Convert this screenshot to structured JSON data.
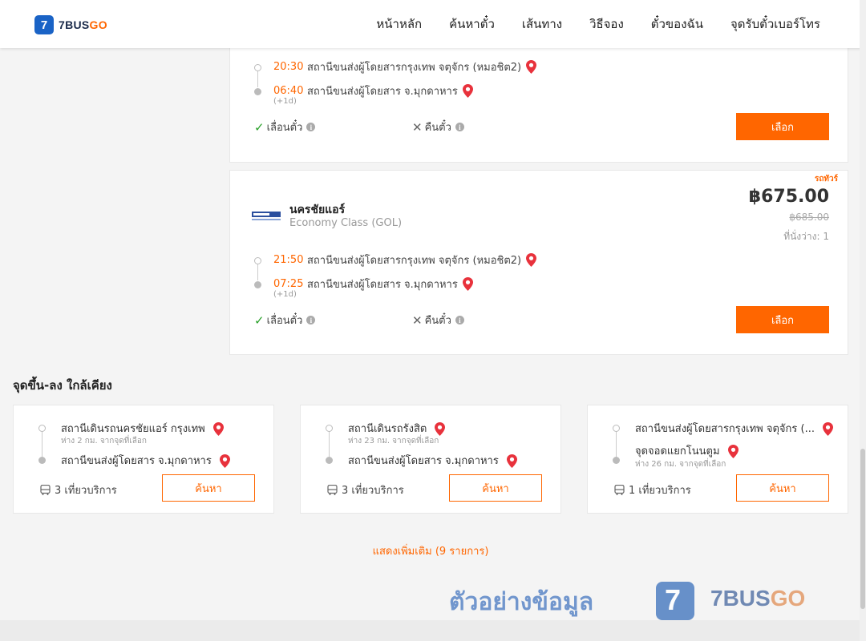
{
  "header": {
    "logo_badge": "7",
    "logo_text_a": "7BUS",
    "logo_text_b": "GO",
    "nav": [
      "หน้าหลัก",
      "ค้นหาตั๋ว",
      "เส้นทาง",
      "วิธีจอง",
      "ตั๋วของฉัน",
      "จุดรับตั๋วเบอร์โทร"
    ]
  },
  "trips": [
    {
      "depart_time": "20:30",
      "depart_stop": "สถานีขนส่งผู้โดยสารกรุงเทพ จตุจักร (หมอชิต2)",
      "arrive_time": "06:40",
      "arrive_stop": "สถานีขนส่งผู้โดยสาร จ.มุกดาหาร",
      "next_day": "(+1d)",
      "reschedule": "เลื่อนตั๋ว",
      "refund": "คืนตั๋ว",
      "select_label": "เลือก"
    },
    {
      "operator": "นครชัยแอร์",
      "bus_class": "Economy Class (GOL)",
      "promo": "รถทัวร์",
      "price": "฿675.00",
      "old_price": "฿685.00",
      "seats": "ที่นั่งว่าง: 1",
      "depart_time": "21:50",
      "depart_stop": "สถานีขนส่งผู้โดยสารกรุงเทพ จตุจักร (หมอชิต2)",
      "arrive_time": "07:25",
      "arrive_stop": "สถานีขนส่งผู้โดยสาร จ.มุกดาหาร",
      "next_day": "(+1d)",
      "reschedule": "เลื่อนตั๋ว",
      "refund": "คืนตั๋ว",
      "select_label": "เลือก"
    }
  ],
  "nearby": {
    "title": "จุดขึ้น-ลง ใกล้เคียง",
    "items": [
      {
        "from": "สถานีเดินรถนครชัยแอร์ กรุงเทพ",
        "from_distance": "ห่าง 2 กม. จากจุดที่เลือก",
        "to": "สถานีขนส่งผู้โดยสาร จ.มุกดาหาร",
        "to_distance": "",
        "services": "3 เที่ยวบริการ",
        "search_label": "ค้นหา"
      },
      {
        "from": "สถานีเดินรถรังสิต",
        "from_distance": "ห่าง 23 กม. จากจุดที่เลือก",
        "to": "สถานีขนส่งผู้โดยสาร จ.มุกดาหาร",
        "to_distance": "",
        "services": "3 เที่ยวบริการ",
        "search_label": "ค้นหา"
      },
      {
        "from": "สถานีขนส่งผู้โดยสารกรุงเทพ จตุจักร (...",
        "from_distance": "",
        "to": "จุดจอดแยกโนนตูม",
        "to_distance": "ห่าง 26 กม. จากจุดที่เลือก",
        "services": "1 เที่ยวบริการ",
        "search_label": "ค้นหา"
      }
    ],
    "show_more": "แสดงเพิ่มเติม (9 รายการ)"
  },
  "watermark": {
    "text": "ตัวอย่างข้อมูล",
    "badge": "7",
    "brand_a": "7BUS",
    "brand_b": "GO"
  },
  "colors": {
    "accent": "#ff6600",
    "brand_blue": "#1a63c6",
    "pin_red": "#e8323c",
    "check_green": "#2aa12a"
  }
}
